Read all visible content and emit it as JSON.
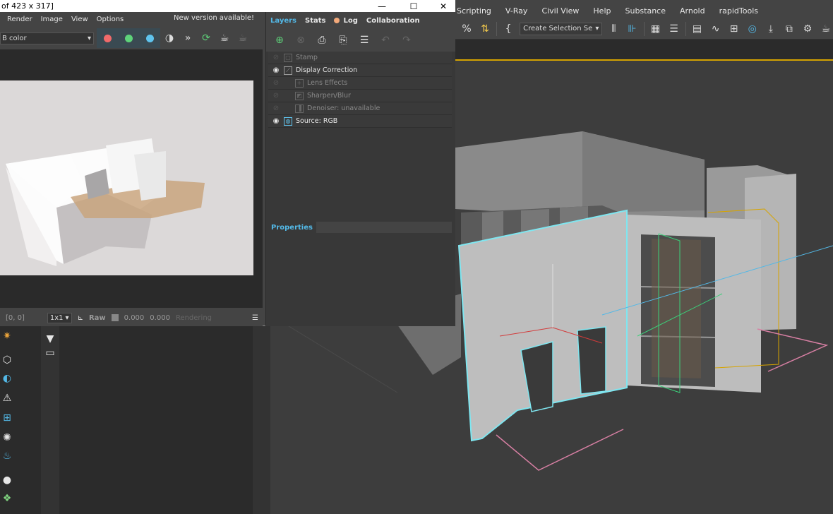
{
  "vfb": {
    "title": "of 423 x 317]",
    "menu": [
      "Render",
      "Image",
      "View",
      "Options"
    ],
    "new_version": "New version available!",
    "channel_select": "B color",
    "status": {
      "coords": "[0, 0]",
      "zoom": "1x1",
      "raw_label": "Raw",
      "value1": "0.000",
      "value2": "0.000",
      "rendering": "Rendering"
    }
  },
  "layers": {
    "tabs": [
      "Layers",
      "Stats",
      "Log",
      "Collaboration"
    ],
    "items": [
      {
        "label": "Stamp",
        "visible": false,
        "indent": 0
      },
      {
        "label": "Display Correction",
        "visible": true,
        "indent": 0
      },
      {
        "label": "Lens Effects",
        "visible": false,
        "indent": 1
      },
      {
        "label": "Sharpen/Blur",
        "visible": false,
        "indent": 1
      },
      {
        "label": "Denoiser: unavailable",
        "visible": false,
        "indent": 1
      },
      {
        "label": "Source: RGB",
        "visible": true,
        "indent": 0
      }
    ],
    "properties_title": "Properties"
  },
  "max": {
    "menu": [
      "Scripting",
      "V-Ray",
      "Civil View",
      "Help",
      "Substance",
      "Arnold",
      "rapidTools"
    ],
    "selection_set": "Create Selection Se"
  },
  "colors": {
    "accent_blue": "#53b8e6",
    "selection_cyan": "#7fe6f0",
    "viewport_bg": "#3d3d3d",
    "gold": "#d6a400"
  },
  "icons": {
    "red_channel": "red-channel-icon",
    "green_channel": "green-channel-icon",
    "blue_channel": "blue-channel-icon"
  }
}
